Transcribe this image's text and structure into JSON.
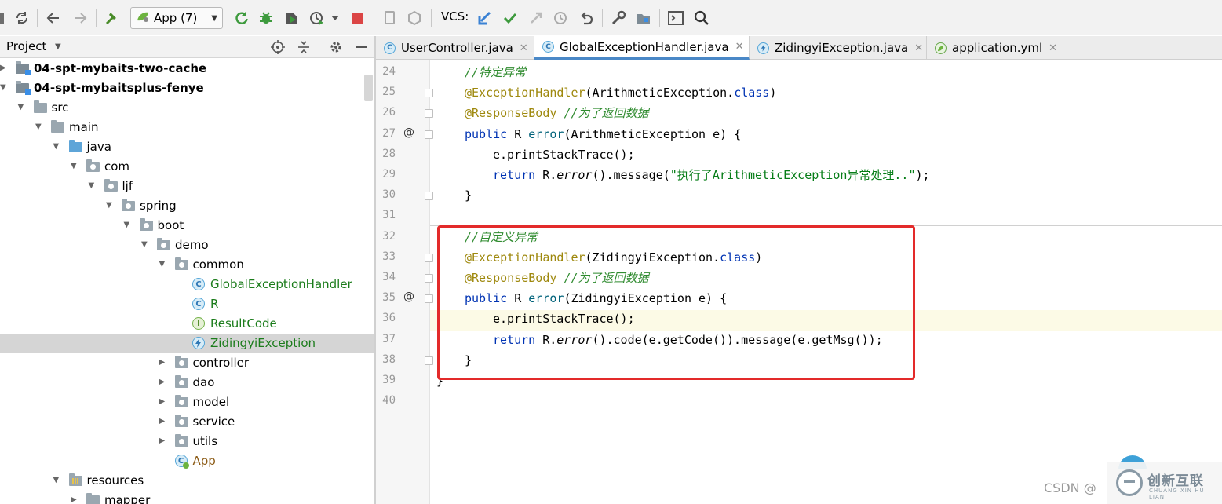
{
  "toolbar": {
    "run_config": "App (7)",
    "vcs_label": "VCS:"
  },
  "project_panel": {
    "title": "Project"
  },
  "tree": [
    {
      "label": "04-spt-mybaits-two-cache",
      "level": 0,
      "expanded": false,
      "kind": "module",
      "style": "bold"
    },
    {
      "label": "04-spt-mybaitsplus-fenye",
      "level": 0,
      "expanded": true,
      "kind": "module",
      "style": "bold"
    },
    {
      "label": "src",
      "level": 1,
      "expanded": true,
      "kind": "folder",
      "style": ""
    },
    {
      "label": "main",
      "level": 2,
      "expanded": true,
      "kind": "folder",
      "style": ""
    },
    {
      "label": "java",
      "level": 3,
      "expanded": true,
      "kind": "source",
      "style": ""
    },
    {
      "label": "com",
      "level": 4,
      "expanded": true,
      "kind": "package",
      "style": ""
    },
    {
      "label": "ljf",
      "level": 5,
      "expanded": true,
      "kind": "package",
      "style": ""
    },
    {
      "label": "spring",
      "level": 6,
      "expanded": true,
      "kind": "package",
      "style": ""
    },
    {
      "label": "boot",
      "level": 7,
      "expanded": true,
      "kind": "package",
      "style": ""
    },
    {
      "label": "demo",
      "level": 8,
      "expanded": true,
      "kind": "package",
      "style": ""
    },
    {
      "label": "common",
      "level": 9,
      "expanded": true,
      "kind": "package",
      "style": ""
    },
    {
      "label": "GlobalExceptionHandler",
      "level": 10,
      "expanded": null,
      "kind": "class",
      "style": "green"
    },
    {
      "label": "R",
      "level": 10,
      "expanded": null,
      "kind": "class",
      "style": "green"
    },
    {
      "label": "ResultCode",
      "level": 10,
      "expanded": null,
      "kind": "interface",
      "style": "green"
    },
    {
      "label": "ZidingyiException",
      "level": 10,
      "expanded": null,
      "kind": "exception",
      "style": "green",
      "selected": true
    },
    {
      "label": "controller",
      "level": 9,
      "expanded": false,
      "kind": "package",
      "style": ""
    },
    {
      "label": "dao",
      "level": 9,
      "expanded": false,
      "kind": "package",
      "style": ""
    },
    {
      "label": "model",
      "level": 9,
      "expanded": false,
      "kind": "package",
      "style": ""
    },
    {
      "label": "service",
      "level": 9,
      "expanded": false,
      "kind": "package",
      "style": ""
    },
    {
      "label": "utils",
      "level": 9,
      "expanded": false,
      "kind": "package",
      "style": ""
    },
    {
      "label": "App",
      "level": 9,
      "expanded": null,
      "kind": "appclass",
      "style": "brown"
    },
    {
      "label": "resources",
      "level": 3,
      "expanded": true,
      "kind": "resources",
      "style": ""
    },
    {
      "label": "mapper",
      "level": 4,
      "expanded": false,
      "kind": "folder",
      "style": ""
    }
  ],
  "tabs": [
    {
      "label": "UserController.java",
      "icon": "class-icon",
      "active": false
    },
    {
      "label": "GlobalExceptionHandler.java",
      "icon": "class-icon",
      "active": true
    },
    {
      "label": "ZidingyiException.java",
      "icon": "exception-class-icon",
      "active": false
    },
    {
      "label": "application.yml",
      "icon": "spring-leaf-icon",
      "active": false
    }
  ],
  "editor": {
    "lines": [
      {
        "n": "24",
        "indent": 1,
        "tokens": [
          {
            "t": "//特定异常",
            "c": "cmt"
          }
        ]
      },
      {
        "n": "25",
        "indent": 1,
        "tokens": [
          {
            "t": "@ExceptionHandler",
            "c": "ann"
          },
          {
            "t": "(ArithmeticException.",
            "c": ""
          },
          {
            "t": "class",
            "c": "kw"
          },
          {
            "t": ")",
            "c": ""
          }
        ]
      },
      {
        "n": "26",
        "indent": 1,
        "tokens": [
          {
            "t": "@ResponseBody",
            "c": "ann"
          },
          {
            "t": " ",
            "c": ""
          },
          {
            "t": "//为了返回数据",
            "c": "cmt"
          }
        ]
      },
      {
        "n": "27",
        "indent": 1,
        "gutter_mark": "@",
        "tokens": [
          {
            "t": "public",
            "c": "kw"
          },
          {
            "t": " R ",
            "c": ""
          },
          {
            "t": "error",
            "c": "fn"
          },
          {
            "t": "(ArithmeticException e) {",
            "c": ""
          }
        ]
      },
      {
        "n": "28",
        "indent": 2,
        "tokens": [
          {
            "t": "e.printStackTrace();",
            "c": ""
          }
        ]
      },
      {
        "n": "29",
        "indent": 2,
        "tokens": [
          {
            "t": "return",
            "c": "kw"
          },
          {
            "t": " R.",
            "c": ""
          },
          {
            "t": "error",
            "c": "it"
          },
          {
            "t": "().message(",
            "c": ""
          },
          {
            "t": "\"执行了ArithmeticException异常处理..\"",
            "c": "str"
          },
          {
            "t": ");",
            "c": ""
          }
        ]
      },
      {
        "n": "30",
        "indent": 1,
        "tokens": [
          {
            "t": "}",
            "c": ""
          }
        ]
      },
      {
        "n": "31",
        "indent": 0,
        "tokens": []
      },
      {
        "n": "32",
        "indent": 1,
        "tokens": [
          {
            "t": "//自定义异常",
            "c": "cmt"
          }
        ]
      },
      {
        "n": "33",
        "indent": 1,
        "tokens": [
          {
            "t": "@ExceptionHandler",
            "c": "ann"
          },
          {
            "t": "(ZidingyiException.",
            "c": ""
          },
          {
            "t": "class",
            "c": "kw"
          },
          {
            "t": ")",
            "c": ""
          }
        ]
      },
      {
        "n": "34",
        "indent": 1,
        "tokens": [
          {
            "t": "@ResponseBody",
            "c": "ann"
          },
          {
            "t": " ",
            "c": ""
          },
          {
            "t": "//为了返回数据",
            "c": "cmt"
          }
        ]
      },
      {
        "n": "35",
        "indent": 1,
        "gutter_mark": "@",
        "tokens": [
          {
            "t": "public",
            "c": "kw"
          },
          {
            "t": " R ",
            "c": ""
          },
          {
            "t": "error",
            "c": "fn"
          },
          {
            "t": "(ZidingyiException e) {",
            "c": ""
          }
        ]
      },
      {
        "n": "36",
        "indent": 2,
        "tokens": [
          {
            "t": "e.printStackTrace();",
            "c": ""
          }
        ]
      },
      {
        "n": "37",
        "indent": 2,
        "tokens": [
          {
            "t": "return",
            "c": "kw"
          },
          {
            "t": " R.",
            "c": ""
          },
          {
            "t": "error",
            "c": "it"
          },
          {
            "t": "().code(e.getCode()).message(e.getMsg());",
            "c": ""
          }
        ]
      },
      {
        "n": "38",
        "indent": 1,
        "tokens": [
          {
            "t": "}",
            "c": ""
          }
        ]
      },
      {
        "n": "39",
        "indent": 0,
        "tokens": [
          {
            "t": "}",
            "c": ""
          }
        ]
      },
      {
        "n": "40",
        "indent": 0,
        "tokens": []
      }
    ]
  },
  "watermark": {
    "csdn": "CSDN @",
    "brand": "创新互联",
    "brand_sub": "CHUANG XIN HU LIAN"
  },
  "colors": {
    "highlight_box": "#e32a2a",
    "active_tab_underline": "#4a88c7",
    "comment": "#2f8b2f",
    "annotation": "#9e880d",
    "keyword": "#0033b3",
    "string": "#067d17"
  }
}
